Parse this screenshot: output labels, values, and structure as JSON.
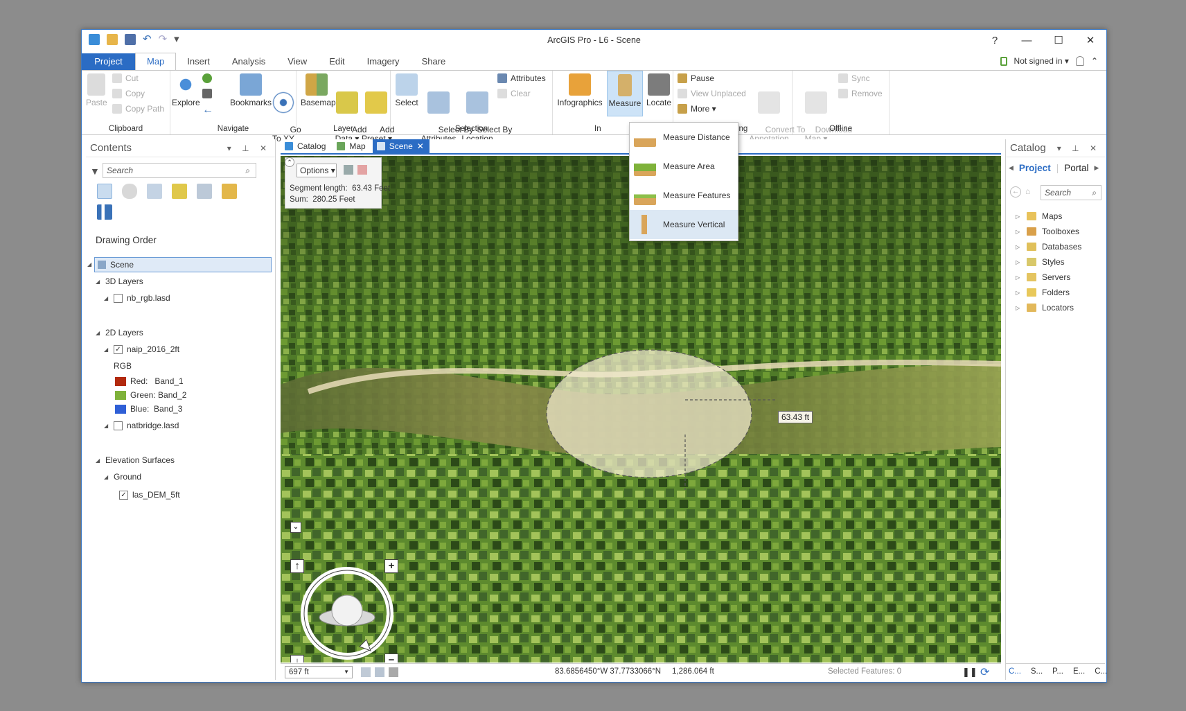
{
  "window": {
    "title": "ArcGIS Pro - L6 - Scene",
    "controls": {
      "help": "?",
      "minimize": "—",
      "maximize": "☐",
      "close": "✕"
    }
  },
  "quick_access": {
    "undo": "↶",
    "redo": "↷",
    "more": "▾"
  },
  "tabs": {
    "project": "Project",
    "items": [
      "Map",
      "Insert",
      "Analysis",
      "View",
      "Edit",
      "Imagery",
      "Share"
    ]
  },
  "account": {
    "signin": "Not signed in ▾",
    "collapse": "⌃"
  },
  "ribbon": {
    "clipboard": {
      "paste": "Paste",
      "cut": "Cut",
      "copy": "Copy",
      "copy_path": "Copy Path",
      "label": "Clipboard"
    },
    "navigate": {
      "explore": "Explore",
      "bookmarks": "Bookmarks",
      "go_to_xy": "Go\nTo XY",
      "label": "Navigate"
    },
    "layer": {
      "basemap": "Basemap",
      "add_data": "Add\nData ▾",
      "add_preset": "Add\nPreset ▾",
      "label": "Layer"
    },
    "selection": {
      "select": "Select",
      "select_by_attributes": "Select By\nAttributes",
      "select_by_location": "Select By\nLocation",
      "attributes": "Attributes",
      "clear": "Clear",
      "label": "Selection"
    },
    "inquiry": {
      "infographics": "Infographics",
      "measure": "Measure",
      "locate": "Locate",
      "label": "In"
    },
    "labeling": {
      "pause": "Pause",
      "view_unplaced": "View Unplaced",
      "more": "More ▾",
      "convert": "Convert To\nAnnotation",
      "label": "Labeling"
    },
    "offline": {
      "download_map": "Download\nMap ▾",
      "sync": "Sync",
      "remove": "Remove",
      "label": "Offline"
    }
  },
  "measure_menu": {
    "items": [
      "Measure Distance",
      "Measure Area",
      "Measure Features",
      "Measure Vertical"
    ],
    "selected": "Measure Vertical"
  },
  "contents": {
    "title": "Contents",
    "search_placeholder": "Search",
    "drawing_order": "Drawing Order",
    "tree": {
      "scene": "Scene",
      "layers_3d": "3D Layers",
      "nb_rgb": "nb_rgb.lasd",
      "layers_2d": "2D Layers",
      "naip": "naip_2016_2ft",
      "rgb": "RGB",
      "red": "Red:   Band_1",
      "green": "Green: Band_2",
      "blue": "Blue:  Band_3",
      "natbridge": "natbridge.lasd",
      "elevation": "Elevation Surfaces",
      "ground": "Ground",
      "las_dem": "las_DEM_5ft"
    },
    "colors": {
      "red": "#b22a0e",
      "green": "#7fb23a",
      "blue": "#2f5fd6"
    }
  },
  "view_tabs": [
    {
      "label": "Catalog",
      "active": false
    },
    {
      "label": "Map",
      "active": false
    },
    {
      "label": "Scene",
      "active": true
    }
  ],
  "measure_panel": {
    "options_label": "Options ▾",
    "segment": "Segment length:  63.43 Feet",
    "sum": "Sum:  280.25 Feet"
  },
  "measure_label": "63.43 ft",
  "status": {
    "scale": "697 ft",
    "coords": "83.6856450°W 37.7733066°N     1,286.064 ft",
    "selected": "Selected Features: 0"
  },
  "catalog": {
    "title": "Catalog",
    "tab_project": "Project",
    "tab_portal": "Portal",
    "search_placeholder": "Search",
    "items": [
      "Maps",
      "Toolboxes",
      "Databases",
      "Styles",
      "Servers",
      "Folders",
      "Locators"
    ],
    "bottom_tabs": [
      "C...",
      "S...",
      "P...",
      "E...",
      "C..."
    ]
  }
}
